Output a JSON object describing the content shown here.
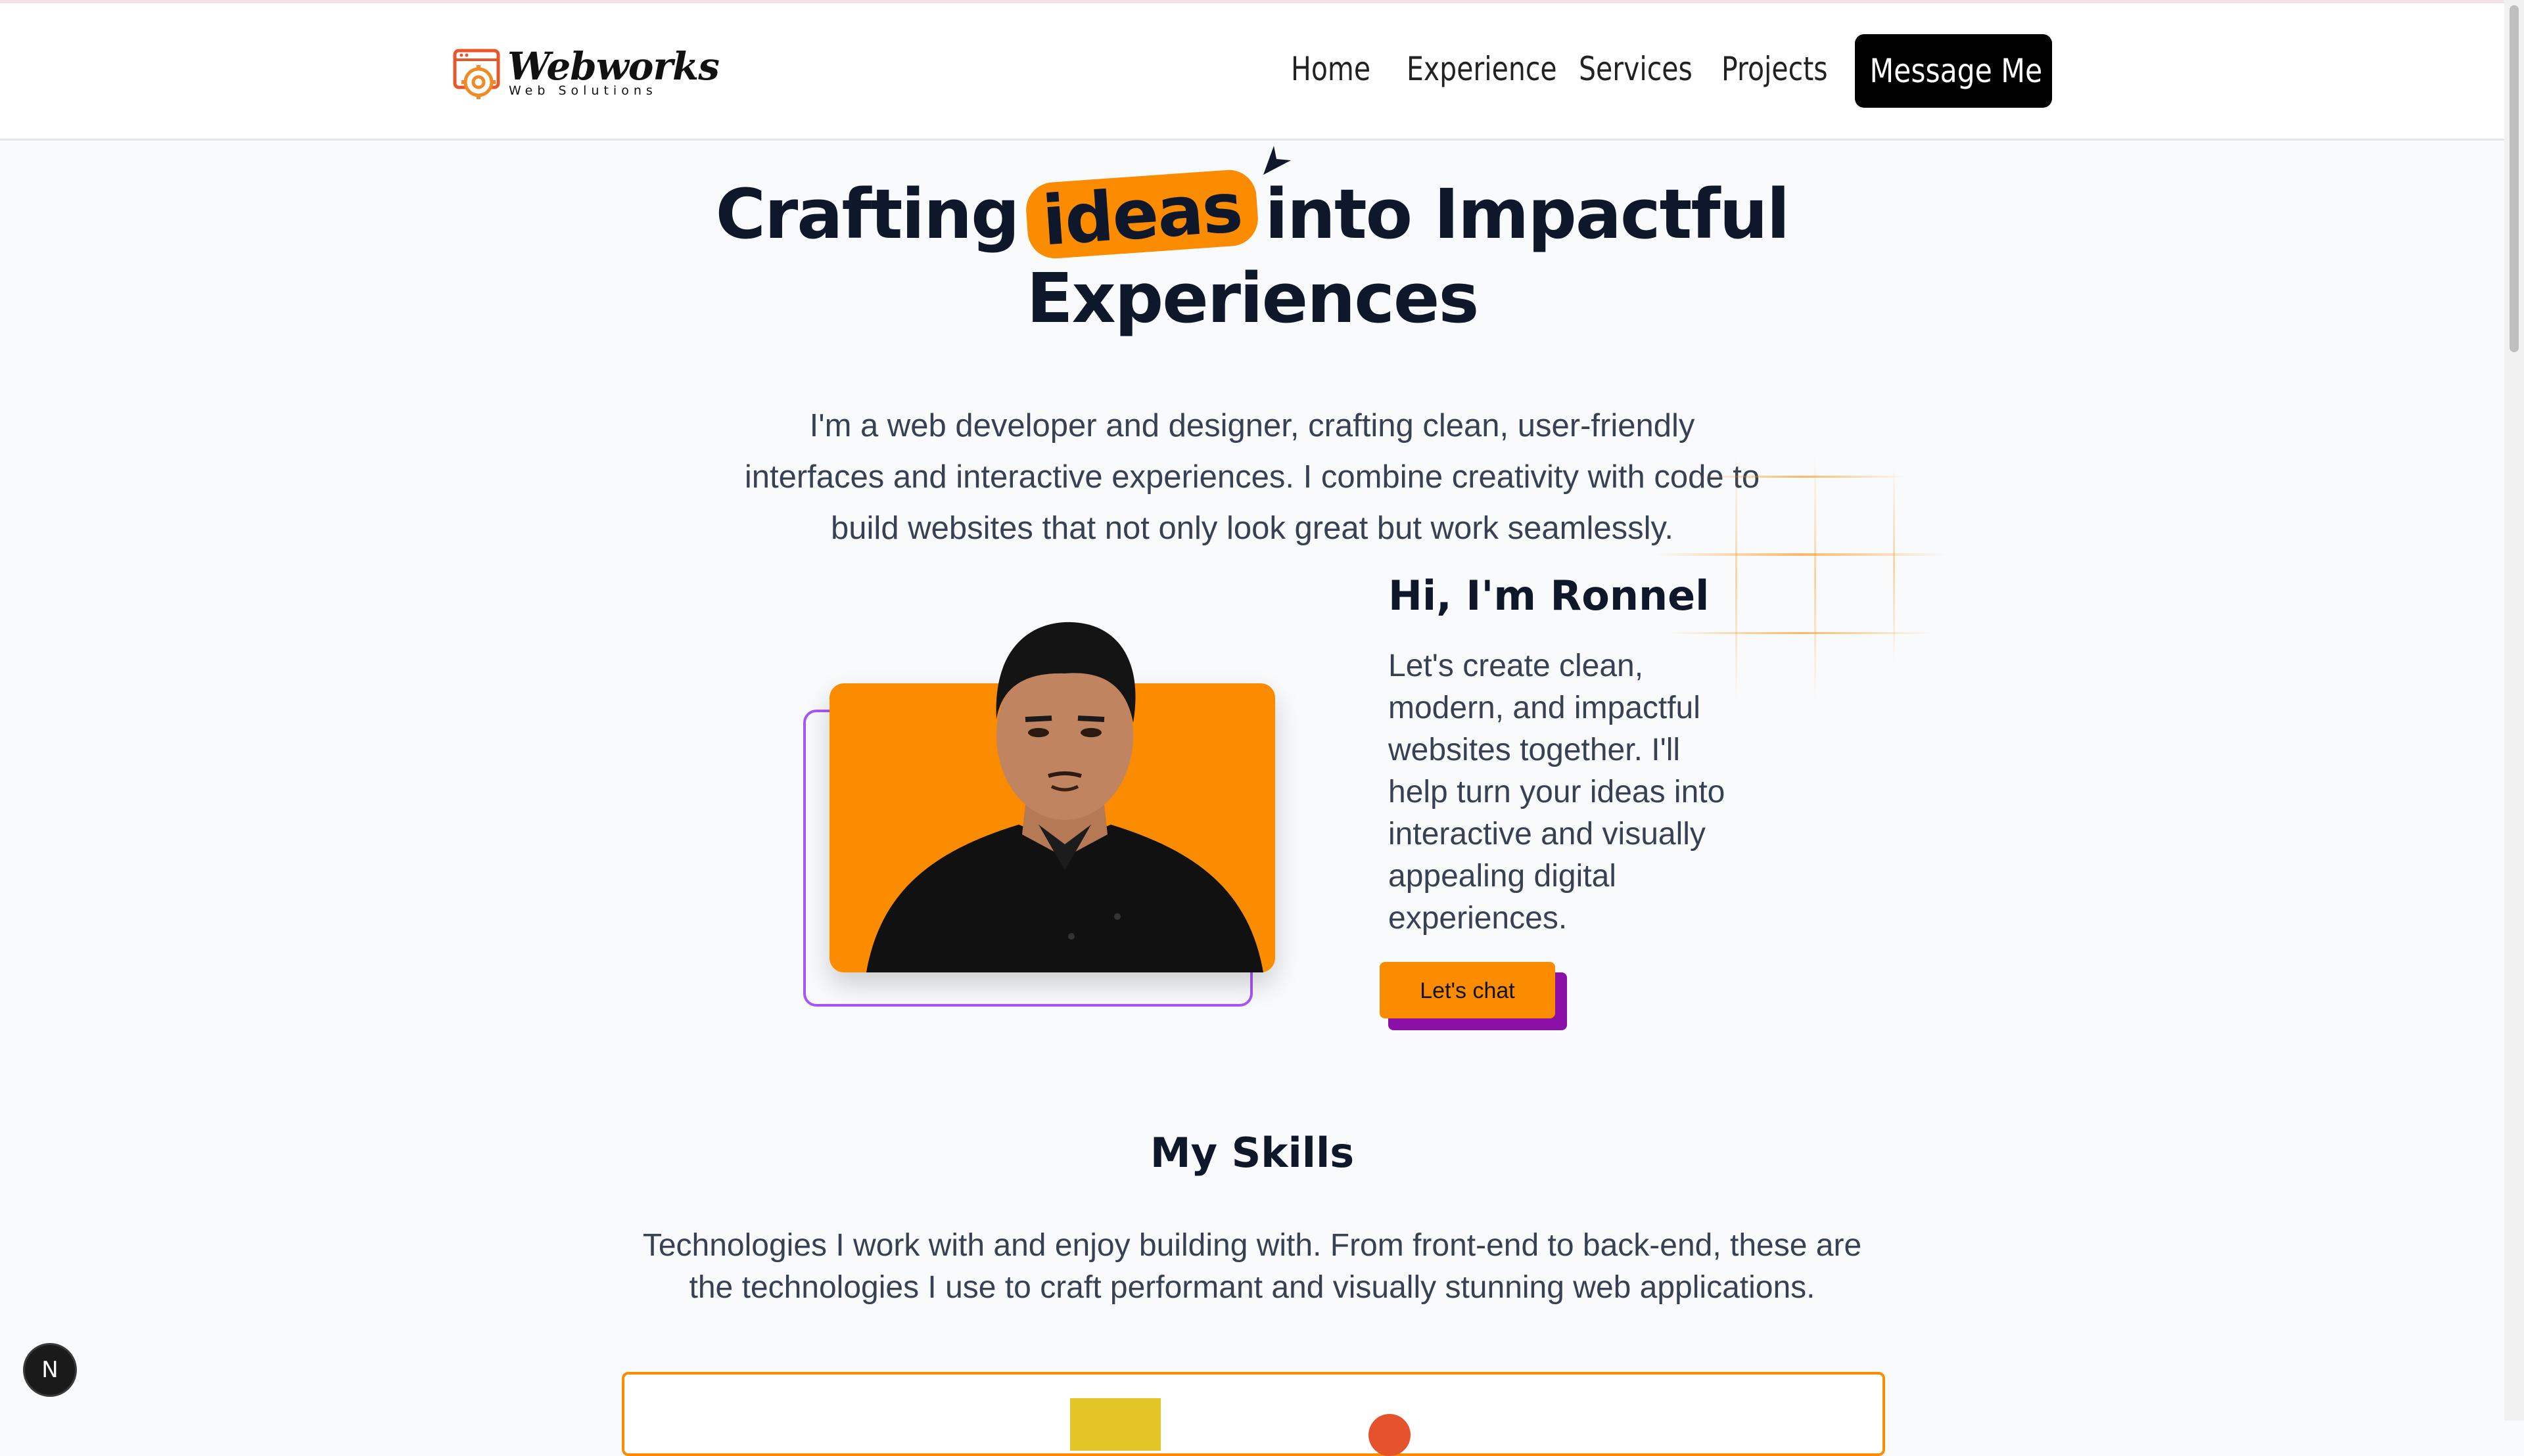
{
  "header": {
    "logo": {
      "title": "Webworks",
      "subtitle": "Web Solutions"
    },
    "nav": [
      "Home",
      "Experience",
      "Services",
      "Projects"
    ],
    "cta": "Message Me"
  },
  "hero": {
    "title_before": "Crafting",
    "title_highlight": "ideas",
    "title_after": "into Impactful Experiences",
    "description": "I'm a web developer and designer, crafting clean, user-friendly interfaces and interactive experiences. I combine creativity with code to build websites that not only look great but work seamlessly."
  },
  "intro": {
    "title": "Hi, I'm Ronnel",
    "text": "Let's create clean, modern, and impactful websites together. I'll help turn your ideas into interactive and visually appealing digital experiences.",
    "button": "Let's chat"
  },
  "skills": {
    "title": "My Skills",
    "description": "Technologies I work with and enjoy building with. From front-end to back-end, these are the technologies I use to craft performant and visually stunning web applications."
  },
  "dev_badge": "N",
  "colors": {
    "accent": "#fb8c00",
    "purple": "#a855f7",
    "dark": "#0f172a"
  }
}
